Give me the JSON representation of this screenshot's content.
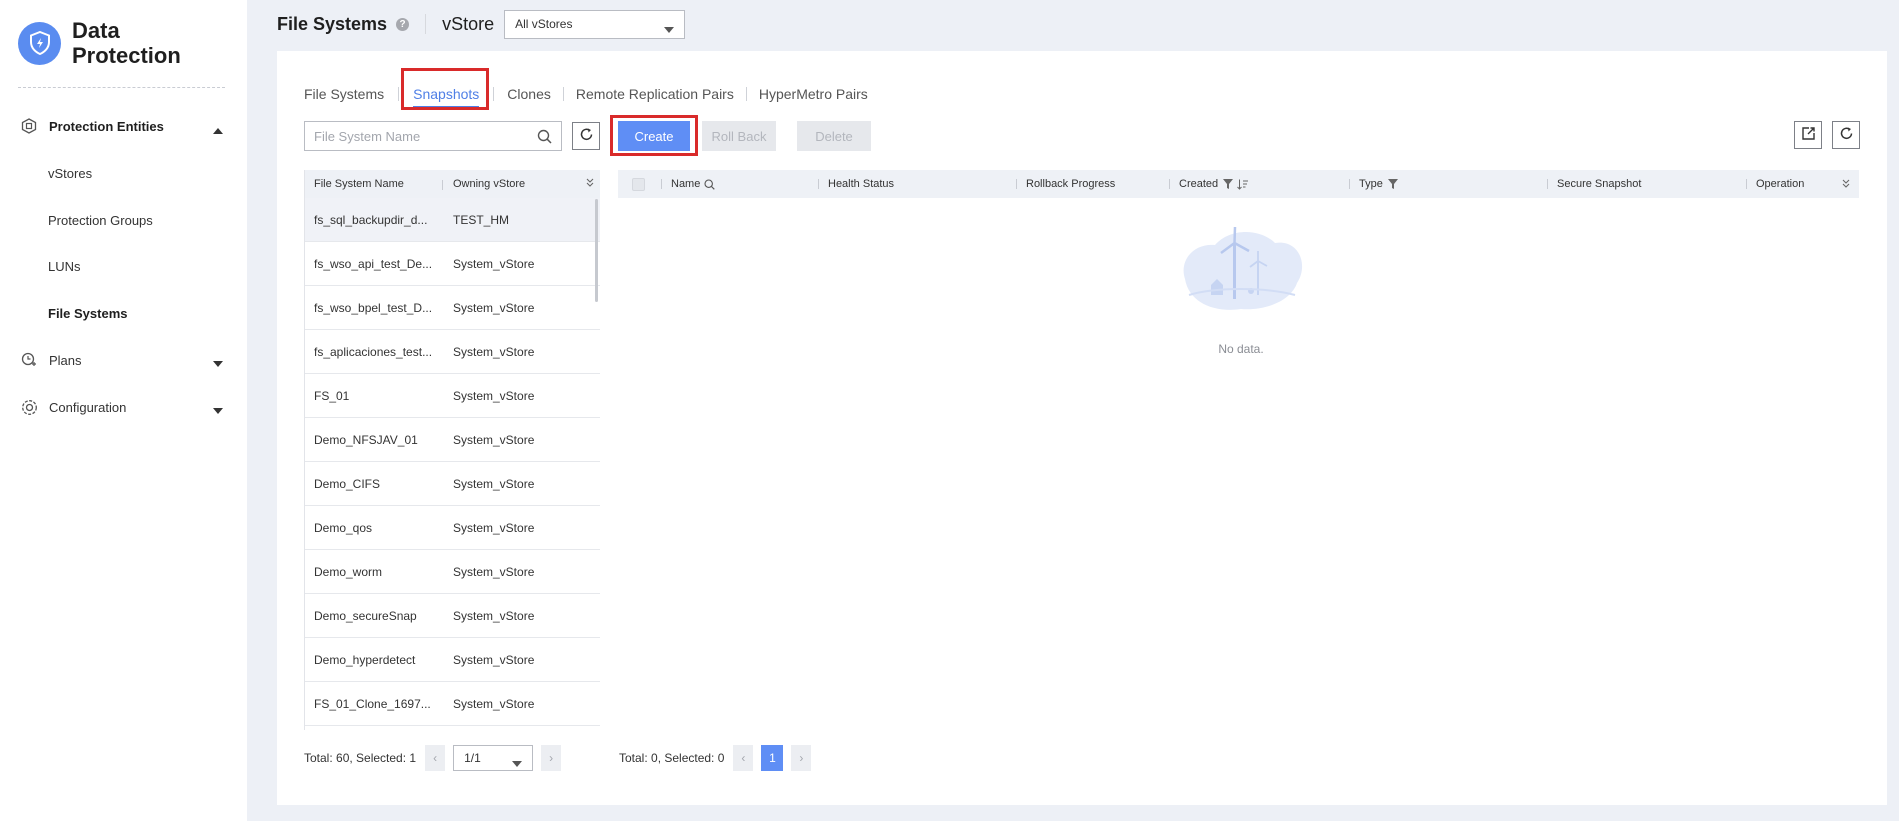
{
  "sidebar": {
    "brand": "Data Protection",
    "groups": [
      {
        "label": "Protection Entities",
        "icon": "entities-icon",
        "expanded": true
      },
      {
        "label": "Plans",
        "icon": "plans-icon",
        "expanded": false
      },
      {
        "label": "Configuration",
        "icon": "gear-icon",
        "expanded": false
      }
    ],
    "items": [
      {
        "label": "vStores"
      },
      {
        "label": "Protection Groups"
      },
      {
        "label": "LUNs"
      },
      {
        "label": "File Systems",
        "active": true
      }
    ]
  },
  "header": {
    "title": "File Systems",
    "help": "?",
    "vstore_label": "vStore",
    "vstore_value": "All vStores"
  },
  "tabs": [
    {
      "label": "File Systems"
    },
    {
      "label": "Snapshots",
      "active": true
    },
    {
      "label": "Clones"
    },
    {
      "label": "Remote Replication Pairs"
    },
    {
      "label": "HyperMetro Pairs"
    }
  ],
  "toolbar": {
    "search_placeholder": "File System Name",
    "create_label": "Create",
    "rollback_label": "Roll Back",
    "delete_label": "Delete"
  },
  "left_table": {
    "columns": [
      "File System Name",
      "Owning vStore"
    ],
    "rows": [
      [
        "fs_sql_backupdir_d...",
        "TEST_HM"
      ],
      [
        "fs_wso_api_test_De...",
        "System_vStore"
      ],
      [
        "fs_wso_bpel_test_D...",
        "System_vStore"
      ],
      [
        "fs_aplicaciones_test...",
        "System_vStore"
      ],
      [
        "FS_01",
        "System_vStore"
      ],
      [
        "Demo_NFSJAV_01",
        "System_vStore"
      ],
      [
        "Demo_CIFS",
        "System_vStore"
      ],
      [
        "Demo_qos",
        "System_vStore"
      ],
      [
        "Demo_worm",
        "System_vStore"
      ],
      [
        "Demo_secureSnap",
        "System_vStore"
      ],
      [
        "Demo_hyperdetect",
        "System_vStore"
      ],
      [
        "FS_01_Clone_1697...",
        "System_vStore"
      ]
    ],
    "footer_total": "Total: 60, Selected: 1",
    "page": "1/1"
  },
  "right_table": {
    "columns": [
      "Name",
      "Health Status",
      "Rollback Progress",
      "Created",
      "Type",
      "Secure Snapshot",
      "Operation"
    ],
    "empty_text": "No data.",
    "footer_total": "Total: 0, Selected: 0",
    "page_number": "1"
  },
  "colors": {
    "accent": "#5f8ef5",
    "highlight": "#d92a2a"
  }
}
